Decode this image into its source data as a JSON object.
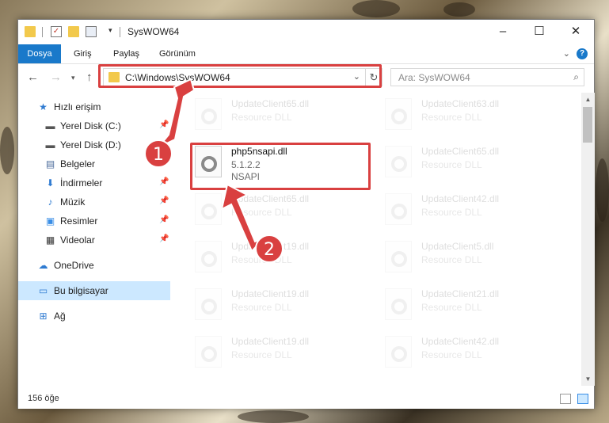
{
  "window": {
    "title": "SysWOW64",
    "minimize_icon": "minimize-icon",
    "maximize_icon": "maximize-icon",
    "close_icon": "close-icon"
  },
  "ribbon": {
    "tabs": [
      {
        "label": "Dosya",
        "active": true
      },
      {
        "label": "Giriş",
        "active": false
      },
      {
        "label": "Paylaş",
        "active": false
      },
      {
        "label": "Görünüm",
        "active": false
      }
    ],
    "help_label": "?"
  },
  "address": {
    "path": "C:\\Windows\\SysWOW64",
    "search_placeholder": "Ara: SysWOW64"
  },
  "sidebar": {
    "items": [
      {
        "label": "Hızlı erişim",
        "icon": "star-icon"
      },
      {
        "label": "Yerel Disk (C:)",
        "icon": "drive-icon",
        "pinned": true
      },
      {
        "label": "Yerel Disk (D:)",
        "icon": "drive-icon",
        "pinned": true
      },
      {
        "label": "Belgeler",
        "icon": "documents-icon",
        "pinned": true
      },
      {
        "label": "İndirmeler",
        "icon": "download-icon",
        "pinned": true
      },
      {
        "label": "Müzik",
        "icon": "music-icon",
        "pinned": true
      },
      {
        "label": "Resimler",
        "icon": "pictures-icon",
        "pinned": true
      },
      {
        "label": "Videolar",
        "icon": "videos-icon",
        "pinned": true
      },
      {
        "label": "OneDrive",
        "icon": "cloud-icon"
      },
      {
        "label": "Bu bilgisayar",
        "icon": "computer-icon",
        "selected": true
      },
      {
        "label": "Ağ",
        "icon": "network-icon"
      }
    ]
  },
  "files": {
    "highlighted": {
      "name": "php5nsapi.dll",
      "version": "5.1.2.2",
      "description": "NSAPI"
    },
    "left_column": [
      {
        "name": "UpdateClient65.dll",
        "description": "Resource DLL"
      },
      {
        "name": "UpdateClient65.dll",
        "description": "Resource DLL"
      },
      {
        "name": "UpdateClient19.dll",
        "description": "Resource DLL"
      },
      {
        "name": "UpdateClient19.dll",
        "description": "Resource DLL"
      },
      {
        "name": "UpdateClient19.dll",
        "description": "Resource DLL"
      }
    ],
    "right_column": [
      {
        "name": "UpdateClient63.dll",
        "description": "Resource DLL"
      },
      {
        "name": "UpdateClient65.dll",
        "description": "Resource DLL"
      },
      {
        "name": "UpdateClient42.dll",
        "description": "Resource DLL"
      },
      {
        "name": "UpdateClient5.dll",
        "description": "Resource DLL"
      },
      {
        "name": "UpdateClient21.dll",
        "description": "Resource DLL"
      },
      {
        "name": "UpdateClient42.dll",
        "description": "Resource DLL"
      }
    ]
  },
  "status": {
    "item_count": "156 öğe"
  },
  "callouts": {
    "first": "1",
    "second": "2"
  },
  "colors": {
    "accent": "#1979ca",
    "highlight": "#d94040",
    "selected_bg": "#cce8ff"
  }
}
